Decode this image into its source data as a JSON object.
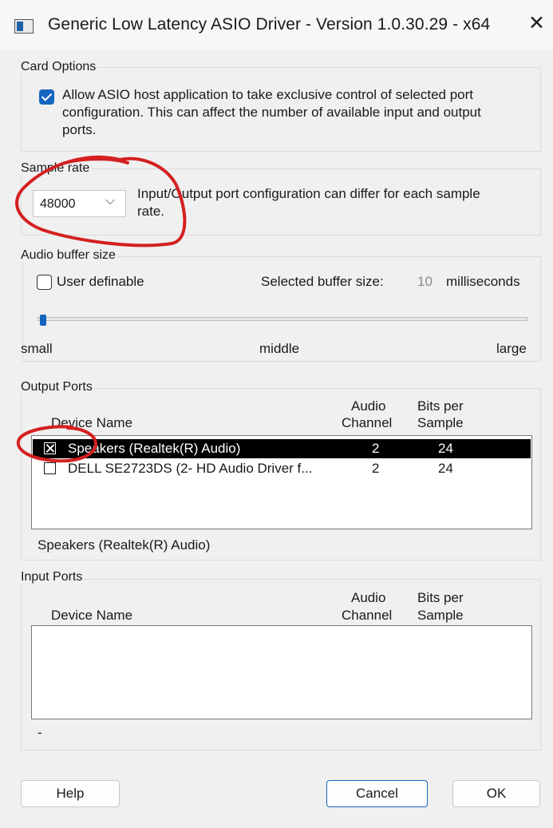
{
  "window": {
    "title": "Generic Low Latency ASIO Driver - Version 1.0.30.29 - x64",
    "close_glyph": "✕"
  },
  "card_options": {
    "label": "Card Options",
    "exclusive_line1": "Allow ASIO host application to take exclusive control of selected port",
    "exclusive_line2": "configuration. This can affect the number of available input and output",
    "exclusive_line3": "ports.",
    "exclusive_checked": true
  },
  "sample_rate": {
    "label": "Sample rate",
    "selected": "48000",
    "note_line1": "Input/Output port configuration can differ for each sample",
    "note_line2": "rate."
  },
  "buffer": {
    "label": "Audio buffer size",
    "user_definable_label": "User definable",
    "user_definable_checked": false,
    "selected_label": "Selected buffer size:",
    "selected_value": "10",
    "unit": "milliseconds",
    "slider_position": 0,
    "tick_small": "small",
    "tick_middle": "middle",
    "tick_large": "large"
  },
  "output_ports": {
    "label": "Output Ports",
    "col_device": "Device Name",
    "col_channel_1": "Audio",
    "col_channel_2": "Channel",
    "col_bits_1": "Bits per",
    "col_bits_2": "Sample",
    "rows": [
      {
        "name": "Speakers (Realtek(R) Audio)",
        "channels": "2",
        "bits": "24",
        "checked": true,
        "selected": true
      },
      {
        "name": "DELL SE2723DS (2- HD Audio Driver f...",
        "channels": "2",
        "bits": "24",
        "checked": false,
        "selected": false
      }
    ],
    "status": "Speakers (Realtek(R) Audio)"
  },
  "input_ports": {
    "label": "Input Ports",
    "col_device": "Device Name",
    "col_channel_1": "Audio",
    "col_channel_2": "Channel",
    "col_bits_1": "Bits per",
    "col_bits_2": "Sample",
    "status": "-"
  },
  "buttons": {
    "help": "Help",
    "cancel": "Cancel",
    "ok": "OK"
  },
  "colors": {
    "accent": "#1565c0",
    "annotation": "#d42020"
  }
}
